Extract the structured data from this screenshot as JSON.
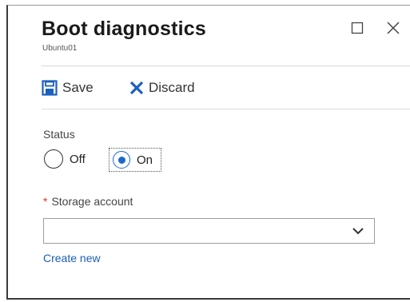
{
  "header": {
    "title": "Boot diagnostics",
    "subtitle": "Ubuntu01"
  },
  "toolbar": {
    "save_label": "Save",
    "discard_label": "Discard"
  },
  "status": {
    "label": "Status",
    "options": [
      {
        "label": "Off",
        "selected": false
      },
      {
        "label": "On",
        "selected": true
      }
    ]
  },
  "storage": {
    "required_marker": "*",
    "label": "Storage account",
    "selected_value": "",
    "create_link": "Create new"
  },
  "colors": {
    "accent": "#1b6ac9",
    "link": "#1a5fb4",
    "required": "#d33333",
    "discard_icon": "#1b5fbf",
    "save_icon": "#1b5fbf"
  },
  "icons": {
    "save": "save-icon",
    "discard": "discard-x-icon",
    "maximize": "maximize-icon",
    "close": "close-icon",
    "dropdown": "chevron-down-icon"
  }
}
